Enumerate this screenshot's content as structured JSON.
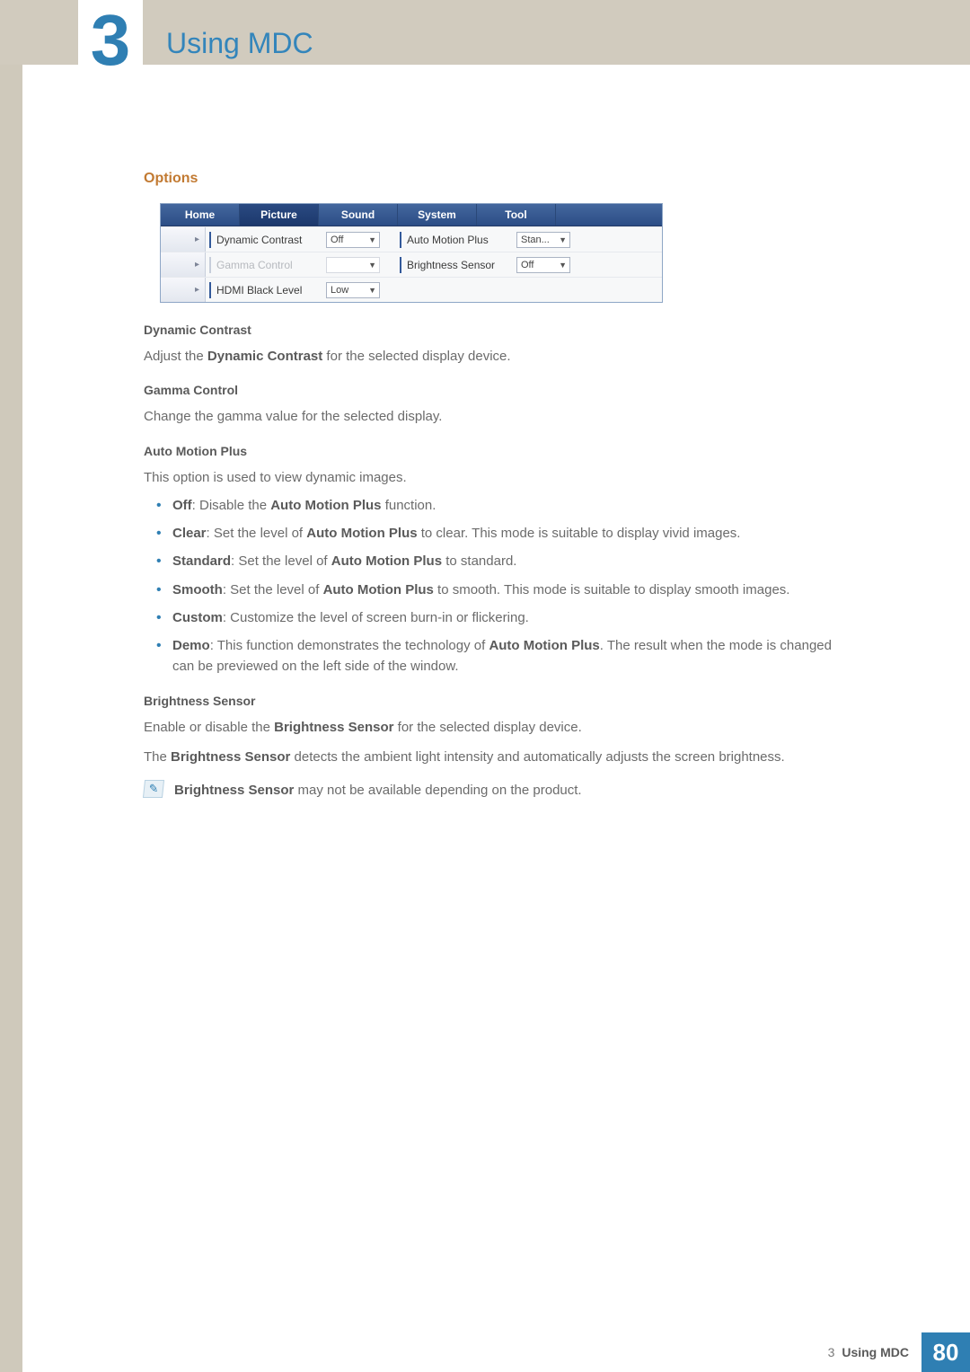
{
  "chapter": {
    "number": "3",
    "title": "Using MDC"
  },
  "section": "Options",
  "ui": {
    "tabs": [
      "Home",
      "Picture",
      "Sound",
      "System",
      "Tool"
    ],
    "active_tab": 1,
    "rows": [
      {
        "left_label": "Dynamic Contrast",
        "left_value": "Off",
        "left_disabled": false,
        "right_label": "Auto Motion Plus",
        "right_value": "Stan...",
        "right_disabled": false
      },
      {
        "left_label": "Gamma Control",
        "left_value": "",
        "left_disabled": true,
        "right_label": "Brightness Sensor",
        "right_value": "Off",
        "right_disabled": false
      },
      {
        "left_label": "HDMI Black Level",
        "left_value": "Low",
        "left_disabled": false,
        "right_label": "",
        "right_value": "",
        "right_disabled": true
      }
    ]
  },
  "dynamic_contrast": {
    "heading": "Dynamic Contrast",
    "text_pre": "Adjust the ",
    "text_bold": "Dynamic Contrast",
    "text_post": " for the selected display device."
  },
  "gamma_control": {
    "heading": "Gamma Control",
    "text": "Change the gamma value for the selected display."
  },
  "auto_motion_plus": {
    "heading": "Auto Motion Plus",
    "intro": "This option is used to view dynamic images.",
    "items": [
      {
        "bold": "Off",
        "sep": ": Disable the ",
        "bold2": "Auto Motion Plus",
        "rest": " function."
      },
      {
        "bold": "Clear",
        "sep": ": Set the level of ",
        "bold2": "Auto Motion Plus",
        "rest": " to clear. This mode is suitable to display vivid images."
      },
      {
        "bold": "Standard",
        "sep": ": Set the level of ",
        "bold2": "Auto Motion Plus",
        "rest": " to standard."
      },
      {
        "bold": "Smooth",
        "sep": ": Set the level of ",
        "bold2": "Auto Motion Plus",
        "rest": " to smooth. This mode is suitable to display smooth images."
      },
      {
        "bold": "Custom",
        "sep": ": Customize the level of screen burn-in or flickering.",
        "bold2": "",
        "rest": ""
      },
      {
        "bold": "Demo",
        "sep": ": This function demonstrates the technology of ",
        "bold2": "Auto Motion Plus",
        "rest": ". The result when the mode is changed can be previewed on the left side of the window."
      }
    ]
  },
  "brightness_sensor": {
    "heading": "Brightness Sensor",
    "p1_pre": "Enable or disable the ",
    "p1_bold": "Brightness Sensor",
    "p1_post": " for the selected display device.",
    "p2_pre": "The ",
    "p2_bold": "Brightness Sensor",
    "p2_post": " detects the ambient light intensity and automatically adjusts the screen brightness.",
    "note_bold": "Brightness Sensor",
    "note_rest": " may not be available depending on the product."
  },
  "footer": {
    "chapter_num": "3",
    "chapter_title": "Using MDC",
    "page": "80"
  }
}
